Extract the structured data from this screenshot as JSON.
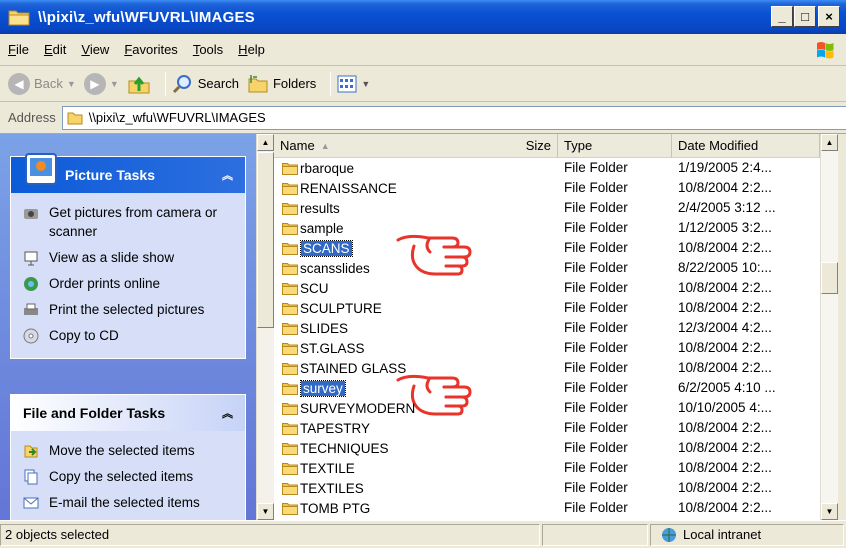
{
  "window": {
    "title": "\\\\pixi\\z_wfu\\WFUVRL\\IMAGES",
    "minimize": "_",
    "maximize": "□",
    "close": "×"
  },
  "menu": [
    "File",
    "Edit",
    "View",
    "Favorites",
    "Tools",
    "Help"
  ],
  "toolbar": {
    "back_label": "Back",
    "search_label": "Search",
    "folders_label": "Folders"
  },
  "address": {
    "label": "Address",
    "path": "\\\\pixi\\z_wfu\\WFUVRL\\IMAGES"
  },
  "picture_tasks": {
    "title": "Picture Tasks",
    "items": [
      "Get pictures from camera or scanner",
      "View as a slide show",
      "Order prints online",
      "Print the selected pictures",
      "Copy to CD"
    ]
  },
  "file_folder_tasks": {
    "title": "File and Folder Tasks",
    "items": [
      "Move the selected items",
      "Copy the selected items",
      "E-mail the selected items"
    ]
  },
  "columns": {
    "name": "Name",
    "size": "Size",
    "type": "Type",
    "date": "Date Modified"
  },
  "files": [
    {
      "name": "rbaroque",
      "type": "File Folder",
      "date": "1/19/2005 2:4...",
      "selected": false
    },
    {
      "name": "RENAISSANCE",
      "type": "File Folder",
      "date": "10/8/2004 2:2...",
      "selected": false
    },
    {
      "name": "results",
      "type": "File Folder",
      "date": "2/4/2005 3:12 ...",
      "selected": false
    },
    {
      "name": "sample",
      "type": "File Folder",
      "date": "1/12/2005 3:2...",
      "selected": false
    },
    {
      "name": "SCANS",
      "type": "File Folder",
      "date": "10/8/2004 2:2...",
      "selected": true
    },
    {
      "name": "scansslides",
      "type": "File Folder",
      "date": "8/22/2005 10:...",
      "selected": false
    },
    {
      "name": "SCU",
      "type": "File Folder",
      "date": "10/8/2004 2:2...",
      "selected": false
    },
    {
      "name": "SCULPTURE",
      "type": "File Folder",
      "date": "10/8/2004 2:2...",
      "selected": false
    },
    {
      "name": "SLIDES",
      "type": "File Folder",
      "date": "12/3/2004 4:2...",
      "selected": false
    },
    {
      "name": "ST.GLASS",
      "type": "File Folder",
      "date": "10/8/2004 2:2...",
      "selected": false
    },
    {
      "name": "STAINED GLASS",
      "type": "File Folder",
      "date": "10/8/2004 2:2...",
      "selected": false
    },
    {
      "name": "survey",
      "type": "File Folder",
      "date": "6/2/2005 4:10 ...",
      "selected": true
    },
    {
      "name": "SURVEYMODERN",
      "type": "File Folder",
      "date": "10/10/2005 4:...",
      "selected": false
    },
    {
      "name": "TAPESTRY",
      "type": "File Folder",
      "date": "10/8/2004 2:2...",
      "selected": false
    },
    {
      "name": "TECHNIQUES",
      "type": "File Folder",
      "date": "10/8/2004 2:2...",
      "selected": false
    },
    {
      "name": "TEXTILE",
      "type": "File Folder",
      "date": "10/8/2004 2:2...",
      "selected": false
    },
    {
      "name": "TEXTILES",
      "type": "File Folder",
      "date": "10/8/2004 2:2...",
      "selected": false
    },
    {
      "name": "TOMB PTG",
      "type": "File Folder",
      "date": "10/8/2004 2:2...",
      "selected": false
    }
  ],
  "status": {
    "left": "2 objects selected",
    "zone": "Local intranet"
  },
  "colors": {
    "title_blue": "#0a51d3",
    "selection": "#316ac5",
    "pointer_red": "#e8342a"
  }
}
